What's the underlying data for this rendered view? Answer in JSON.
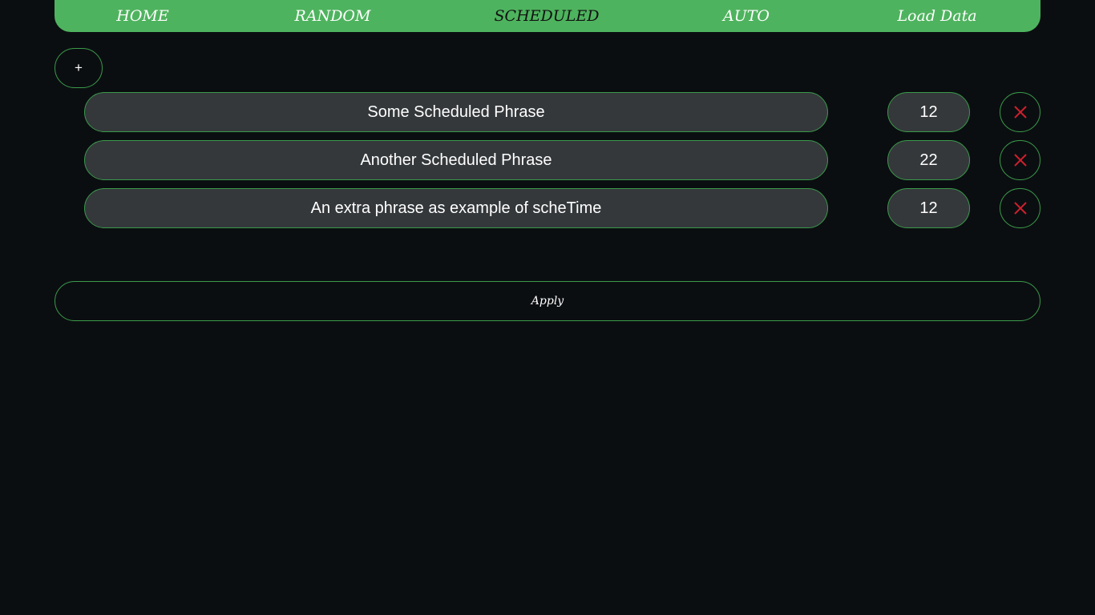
{
  "nav": {
    "items": [
      {
        "label": "HOME",
        "active": false
      },
      {
        "label": "RANDOM",
        "active": false
      },
      {
        "label": "SCHEDULED",
        "active": true
      },
      {
        "label": "AUTO",
        "active": false
      },
      {
        "label": "Load Data",
        "active": false
      }
    ]
  },
  "add_button": {
    "label": "+"
  },
  "schedule": {
    "rows": [
      {
        "phrase": "Some Scheduled Phrase",
        "time": "12"
      },
      {
        "phrase": "Another Scheduled Phrase",
        "time": "22"
      },
      {
        "phrase": "An extra phrase as example of scheTime",
        "time": "12"
      }
    ]
  },
  "apply_button": {
    "label": "Apply"
  },
  "colors": {
    "nav_bg": "#4eb35e",
    "border": "#3a9a4a",
    "page_bg": "#0b0e11",
    "field_bg": "#34383b",
    "delete_icon": "#d0202e"
  },
  "icons": {
    "delete": "close-x-icon"
  }
}
